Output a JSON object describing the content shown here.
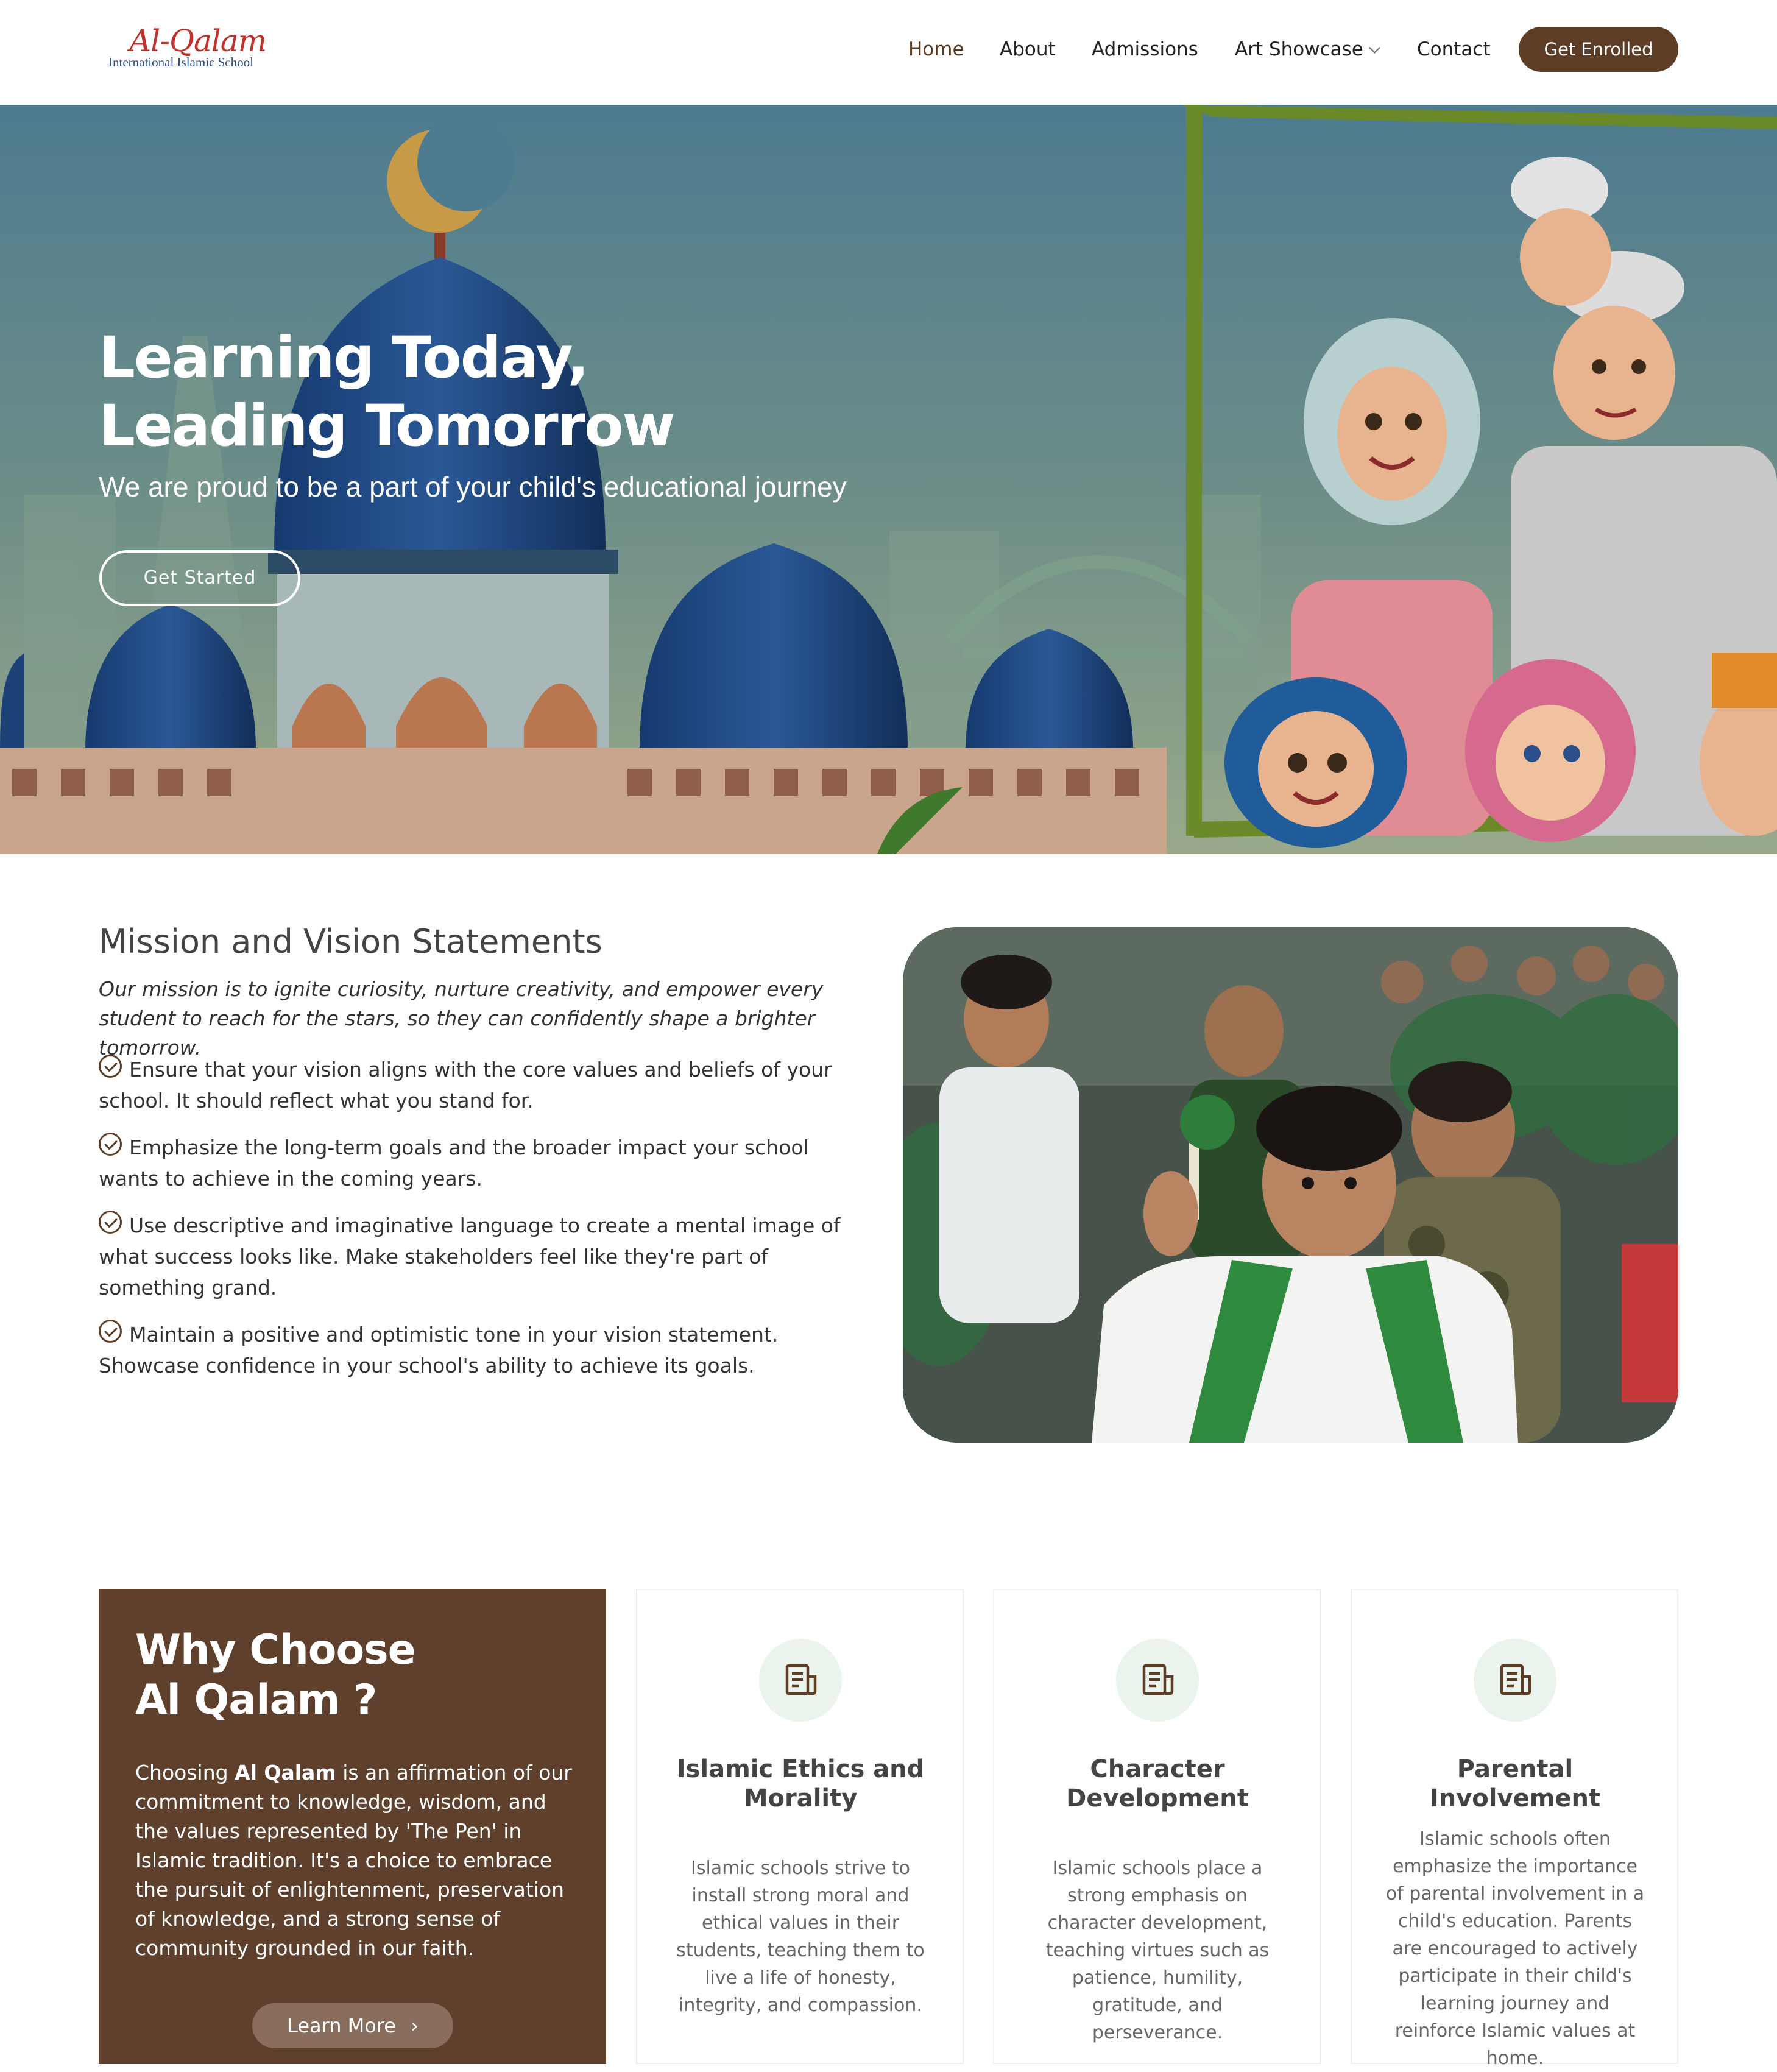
{
  "header": {
    "logo_main": "Al-Qalam",
    "logo_sub": "International Islamic School",
    "nav": [
      "Home",
      "About",
      "Admissions",
      "Art Showcase",
      "Contact"
    ],
    "active_nav": "Home",
    "cta": "Get Enrolled"
  },
  "hero": {
    "title_line1": "Learning Today,",
    "title_line2": "Leading Tomorrow",
    "subtitle": "We are proud to be a part of your child's educational journey",
    "button": "Get Started"
  },
  "mission": {
    "title": "Mission and Vision Statements",
    "intro": "Our mission is to ignite curiosity, nurture creativity, and empower every student to reach for the stars, so they can confidently shape a brighter tomorrow.",
    "points": [
      "Ensure that your vision aligns with the core values and beliefs of your school. It should reflect what you stand for.",
      "Emphasize the long-term goals and the broader impact your school wants to achieve in the coming years.",
      "Use descriptive and imaginative language to create a mental image of what success looks like. Make stakeholders feel like they're part of something grand.",
      "Maintain a positive and optimistic tone in your vision statement. Showcase confidence in your school's ability to achieve its goals."
    ]
  },
  "why": {
    "title_line1": "Why Choose",
    "title_line2": "Al Qalam ?",
    "text_prefix": "Choosing ",
    "text_bold": "Al Qalam",
    "text_rest": " is an affirmation of our commitment to knowledge, wisdom, and the values represented by 'The Pen' in Islamic tradition. It's a choice to embrace the pursuit of enlightenment, preservation of knowledge, and a strong sense of community grounded in our faith.",
    "button": "Learn More",
    "button_arrow": "›",
    "cards": [
      {
        "title": "Islamic Ethics and Morality",
        "text": "Islamic schools strive to install strong moral and ethical values in their students, teaching them to live a life of honesty, integrity, and compassion.",
        "icon": "document-icon"
      },
      {
        "title": "Character Development",
        "text": "Islamic schools place a strong emphasis on character development, teaching virtues such as patience, humility, gratitude, and perseverance.",
        "icon": "document-icon"
      },
      {
        "title": "Parental Involvement",
        "text": "Islamic schools often emphasize the importance of parental involvement in a child's education. Parents are encouraged to actively participate in their child's learning journey and reinforce Islamic values at home.",
        "icon": "document-icon"
      }
    ]
  },
  "colors": {
    "brand_brown": "#5e3d27",
    "hero_sky_top": "#4e7d8e",
    "hero_sky_bottom": "#8fa68c",
    "icon_circle": "#eaf4ec"
  }
}
